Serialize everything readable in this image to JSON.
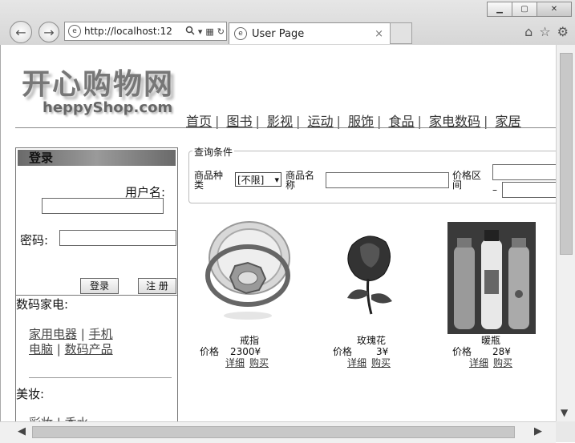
{
  "browser": {
    "url": "http://localhost:12",
    "tab_title": "User Page",
    "tab_close": "×",
    "minimize": "▁",
    "maximize": "▢",
    "close": "✕",
    "back": "←",
    "forward": "→",
    "search_icon": "search-icon",
    "home_icon": "⌂",
    "star_icon": "☆",
    "gear_icon": "⚙"
  },
  "site": {
    "logo_cn": "开心购物网",
    "logo_en": "heppyShop.com",
    "nav": [
      "首页",
      "图书",
      "影视",
      "运动",
      "服饰",
      "食品",
      "家电数码",
      "家居"
    ]
  },
  "login": {
    "title": "登录",
    "username_label": "用户名:",
    "password_label": "密码:",
    "login_button": "登录",
    "register_button": "注 册"
  },
  "categories": [
    {
      "title": "数码家电:",
      "links": [
        "家用电器",
        "手机",
        "电脑",
        "数码产品"
      ]
    },
    {
      "title": "美妆:",
      "links": [
        "彩妆",
        "香水"
      ]
    }
  ],
  "query": {
    "legend": "查询条件",
    "type_label": "商品种类",
    "type_value": "[不限]",
    "name_label": "商品名称",
    "price_label": "价格区间",
    "dash": "–"
  },
  "products": [
    {
      "name": "戒指",
      "price_label": "价格",
      "price": "2300¥",
      "detail": "详细",
      "buy": "购买"
    },
    {
      "name": "玫瑰花",
      "price_label": "价格",
      "price": "3¥",
      "detail": "详细",
      "buy": "购买"
    },
    {
      "name": "暖瓶",
      "price_label": "价格",
      "price": "28¥",
      "detail": "详细",
      "buy": "购买"
    }
  ]
}
